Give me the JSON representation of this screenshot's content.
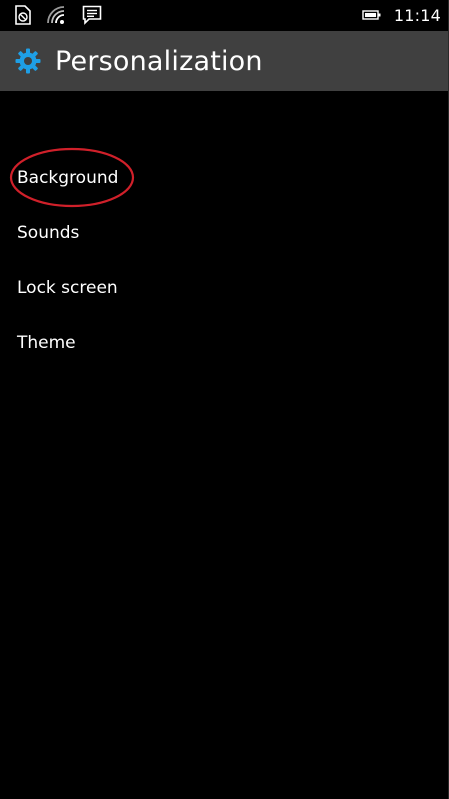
{
  "status_bar": {
    "time": "11:14",
    "icons": [
      "no-sim-icon",
      "wifi-icon",
      "message-icon",
      "battery-icon"
    ]
  },
  "header": {
    "title": "Personalization",
    "icon": "gear-icon",
    "background_color": "#404040",
    "accent_color": "#1e9fe6"
  },
  "menu": {
    "items": [
      {
        "label": "Background",
        "highlighted": true
      },
      {
        "label": "Sounds"
      },
      {
        "label": "Lock screen"
      },
      {
        "label": "Theme"
      }
    ]
  },
  "annotation": {
    "shape": "ellipse",
    "target": "Background",
    "color": "#d0202a"
  }
}
